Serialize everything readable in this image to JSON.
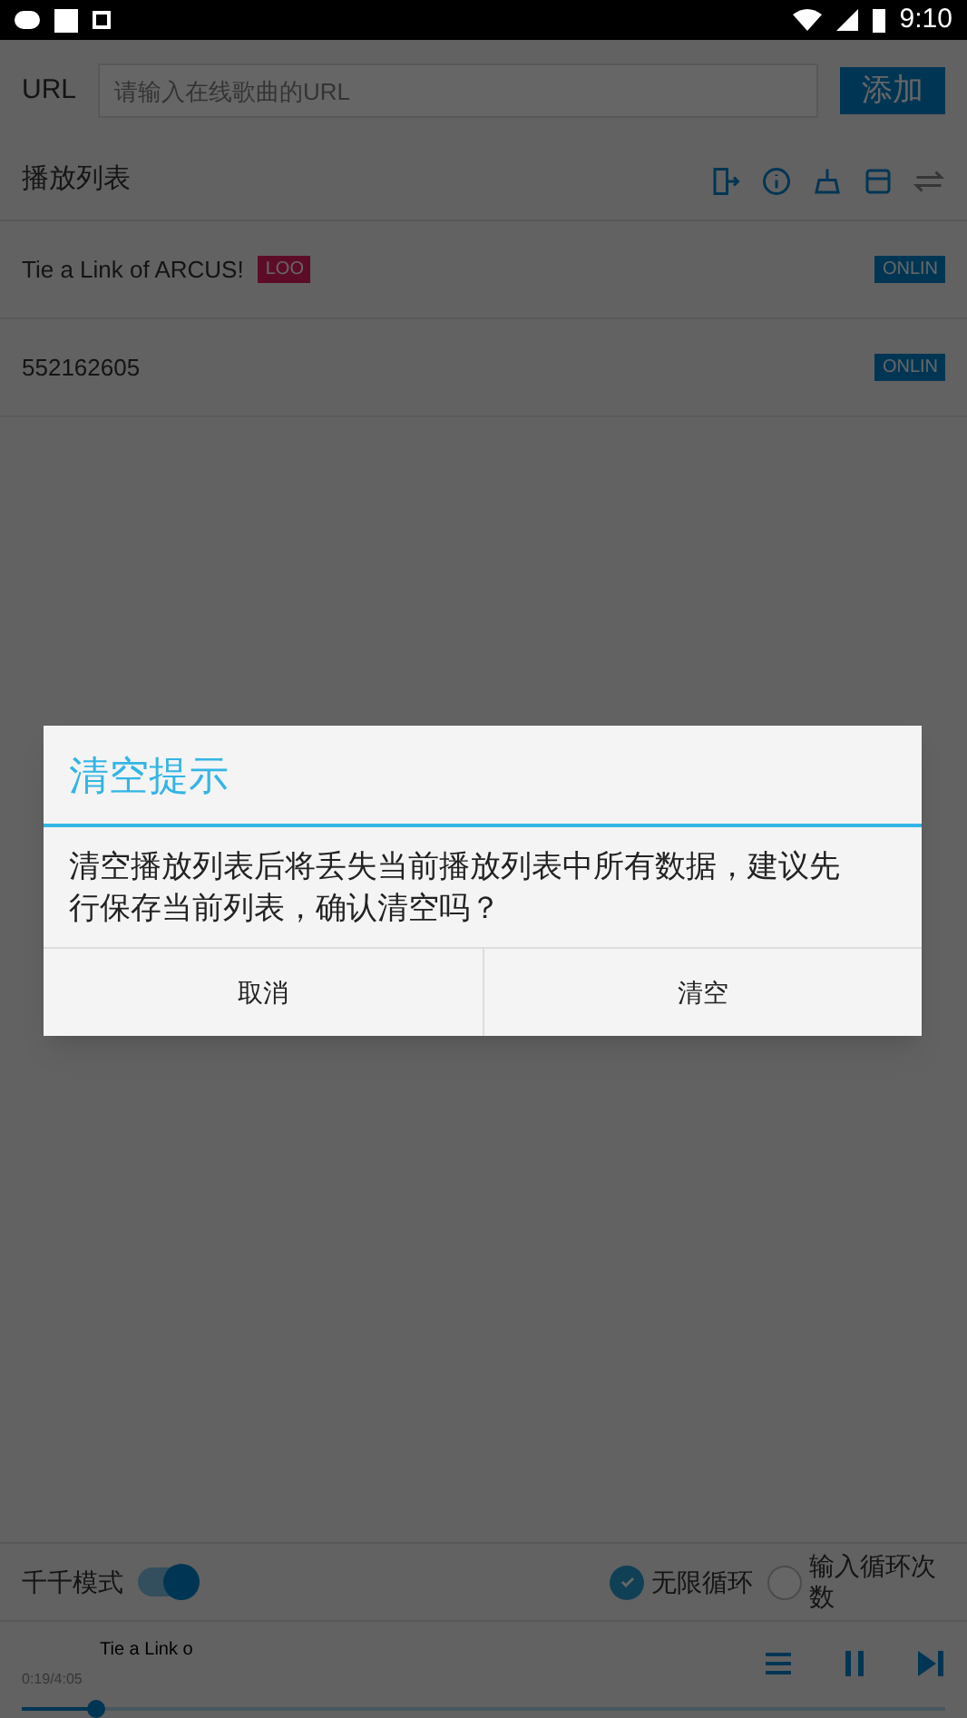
{
  "status_bar": {
    "time": "9:10"
  },
  "url_bar": {
    "label": "URL",
    "placeholder": "请输入在线歌曲的URL",
    "add_button": "添加"
  },
  "playlist": {
    "title": "播放列表",
    "items": [
      {
        "title": "Tie a Link of ARCUS!",
        "tag": "LOO",
        "source": "ONLIN"
      },
      {
        "title": "552162605",
        "source": "ONLIN"
      }
    ]
  },
  "dialog": {
    "title": "清空提示",
    "message": "清空播放列表后将丢失当前播放列表中所有数据，建议先行保存当前列表，确认清空吗？",
    "buttons": [
      "取消",
      "清空"
    ]
  },
  "mode_bar": {
    "switch_label": "千千模式",
    "switch_on": true,
    "loop_options": [
      {
        "label": "无限循环",
        "selected": true
      },
      {
        "label": "输入循环次数",
        "selected": false
      }
    ]
  },
  "player": {
    "title": "Tie a Link o",
    "time": "0:19/4:05",
    "level": 0.08
  }
}
